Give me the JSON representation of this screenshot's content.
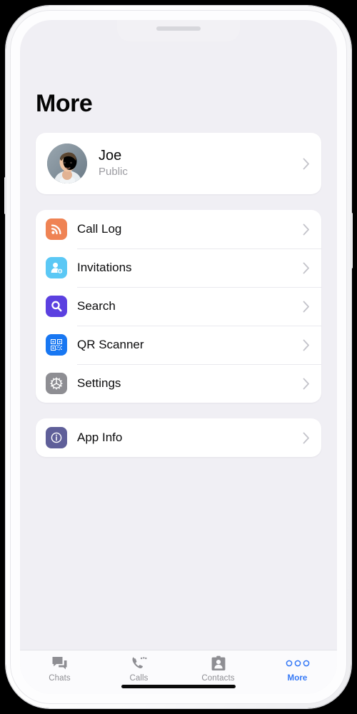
{
  "app": {
    "screen_title": "More",
    "background_color": "#f0eff4",
    "accent_color": "#3478f6"
  },
  "profile": {
    "name": "Joe",
    "status": "Public",
    "avatar_icon": "user-photo",
    "chevron_icon": "chevron-right-icon"
  },
  "menu_primary": [
    {
      "label": "Call Log",
      "icon": "rss-signal-icon",
      "color": "#ef8354",
      "chevron_icon": "chevron-right-icon"
    },
    {
      "label": "Invitations",
      "icon": "person-add-icon",
      "color": "#5bc8f5",
      "chevron_icon": "chevron-right-icon"
    },
    {
      "label": "Search",
      "icon": "magnifier-icon",
      "color": "#5b40e0",
      "chevron_icon": "chevron-right-icon"
    },
    {
      "label": "QR Scanner",
      "icon": "qr-code-icon",
      "color": "#1877f2",
      "chevron_icon": "chevron-right-icon"
    },
    {
      "label": "Settings",
      "icon": "gear-icon",
      "color": "#8e8e93",
      "chevron_icon": "chevron-right-icon"
    }
  ],
  "menu_secondary": [
    {
      "label": "App Info",
      "icon": "info-circle-icon",
      "color": "#5f5f99",
      "chevron_icon": "chevron-right-icon"
    }
  ],
  "tabbar": {
    "tabs": [
      {
        "label": "Chats",
        "icon": "chat-bubbles-icon",
        "active": false
      },
      {
        "label": "Calls",
        "icon": "phone-icon",
        "active": false
      },
      {
        "label": "Contacts",
        "icon": "contact-card-icon",
        "active": false
      },
      {
        "label": "More",
        "icon": "three-dots-icon",
        "active": true
      }
    ]
  }
}
